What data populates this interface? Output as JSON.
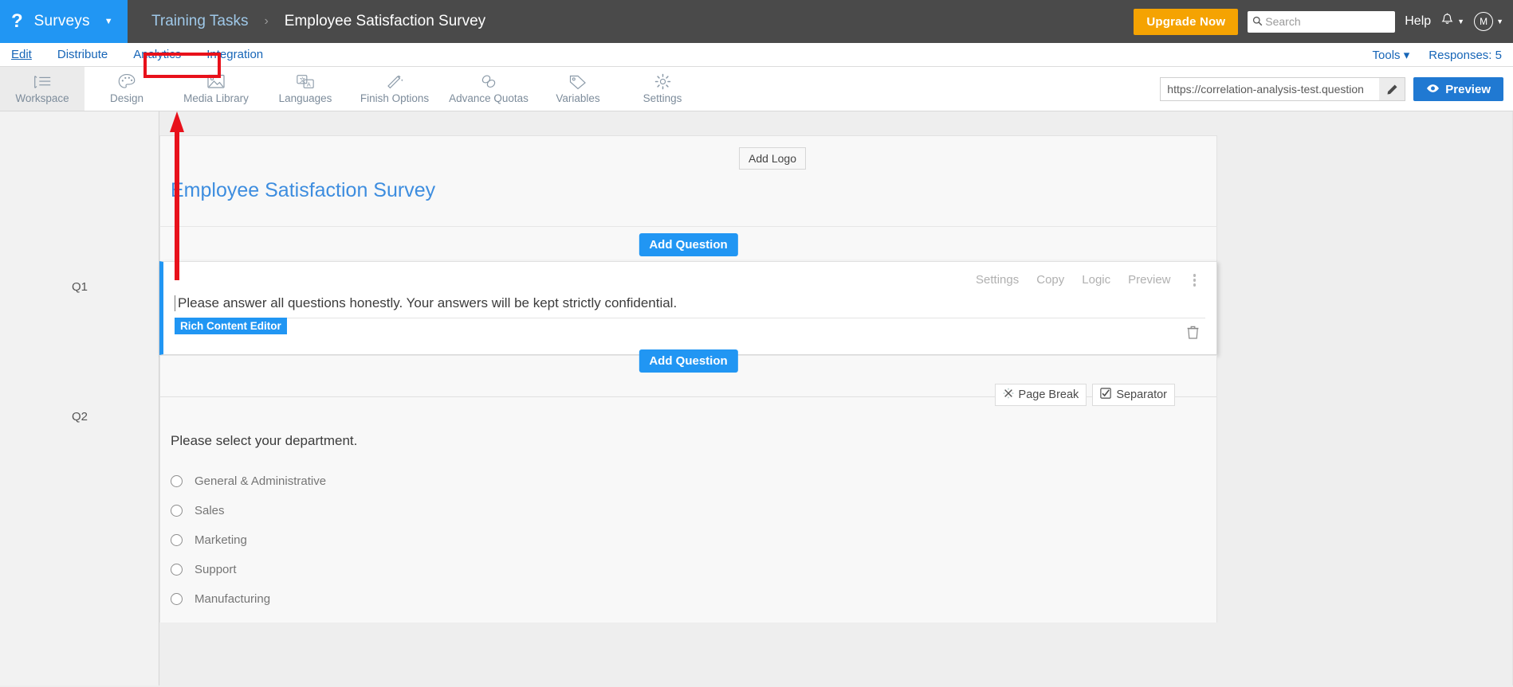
{
  "topbar": {
    "logo_glyph": "?",
    "brand_label": "Surveys",
    "breadcrumb_parent": "Training Tasks",
    "breadcrumb_sep": "›",
    "breadcrumb_current": "Employee Satisfaction Survey",
    "upgrade_label": "Upgrade Now",
    "search_placeholder": "Search",
    "search_value": "",
    "help_label": "Help",
    "avatar_initial": "M"
  },
  "tabrow": {
    "tabs": [
      {
        "label": "Edit",
        "active": true
      },
      {
        "label": "Distribute",
        "active": false
      },
      {
        "label": "Analytics",
        "active": false
      },
      {
        "label": "Integration",
        "active": false
      }
    ],
    "tools_label": "Tools",
    "responses_label": "Responses: 5"
  },
  "toolbar": {
    "items": [
      {
        "label": "Workspace",
        "icon": "workspace-icon",
        "active": true
      },
      {
        "label": "Design",
        "icon": "palette-icon",
        "active": false
      },
      {
        "label": "Media Library",
        "icon": "image-icon",
        "active": false
      },
      {
        "label": "Languages",
        "icon": "translate-icon",
        "active": false
      },
      {
        "label": "Finish Options",
        "icon": "magic-wand-icon",
        "active": false
      },
      {
        "label": "Advance Quotas",
        "icon": "link-icon",
        "active": false
      },
      {
        "label": "Variables",
        "icon": "tag-icon",
        "active": false
      },
      {
        "label": "Settings",
        "icon": "gear-icon",
        "active": false
      }
    ],
    "url_value": "https://correlation-analysis-test.question",
    "preview_label": "Preview"
  },
  "survey": {
    "add_logo_label": "Add Logo",
    "title": "Employee Satisfaction Survey",
    "add_question_top_label": "Add Question",
    "add_question_bottom_label": "Add Question",
    "page_break_label": "Page Break",
    "separator_label": "Separator",
    "questions": [
      {
        "number": "Q1",
        "text": "Please answer all questions honestly. Your answers will be kept strictly confidential.",
        "badge": "Rich Content Editor",
        "actions": [
          "Settings",
          "Copy",
          "Logic",
          "Preview"
        ]
      },
      {
        "number": "Q2",
        "text": "Please select your department.",
        "options": [
          "General & Administrative",
          "Sales",
          "Marketing",
          "Support",
          "Manufacturing"
        ]
      }
    ]
  },
  "annotation": {
    "highlight_color": "#e8111b",
    "target_tab": "Analytics"
  }
}
